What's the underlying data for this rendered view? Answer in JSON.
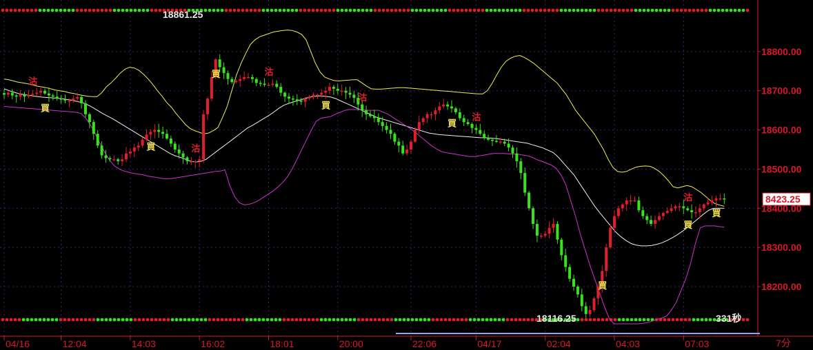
{
  "chart_data": {
    "type": "candlestick",
    "title": "",
    "xlabel": "",
    "ylabel": "",
    "timeframe_label": "7分",
    "ylim": [
      18105,
      18900
    ],
    "y_ticks": [
      18200,
      18300,
      18400,
      18500,
      18600,
      18700,
      18800
    ],
    "y_tick_labels": [
      "18200.00",
      "18300.00",
      "18400.00",
      "18500.00",
      "18600.00",
      "18700.00",
      "18800.00"
    ],
    "x_ticks": [
      {
        "label": "04/16",
        "index": 0
      },
      {
        "label": "12:04",
        "index": 14
      },
      {
        "label": "14:03",
        "index": 31
      },
      {
        "label": "16:02",
        "index": 48
      },
      {
        "label": "18:01",
        "index": 65
      },
      {
        "label": "20:00",
        "index": 82
      },
      {
        "label": "22:06",
        "index": 100
      },
      {
        "label": "04/17",
        "index": 116
      },
      {
        "label": "02:04",
        "index": 133
      },
      {
        "label": "04:03",
        "index": 150
      },
      {
        "label": "07:03",
        "index": 167
      }
    ],
    "last_price": 18423.25,
    "last_price_label": "8423.25",
    "annotations": {
      "high_label": "18861.25",
      "low_label": "18116.25",
      "countdown_label": "331秒"
    },
    "closes": [
      18690,
      18695,
      18688,
      18685,
      18690,
      18685,
      18690,
      18692,
      18695,
      18700,
      18693,
      18688,
      18685,
      18680,
      18678,
      18675,
      18675,
      18680,
      18684,
      18668,
      18640,
      18620,
      18590,
      18560,
      18535,
      18528,
      18525,
      18525,
      18520,
      18525,
      18540,
      18545,
      18555,
      18560,
      18575,
      18588,
      18595,
      18600,
      18595,
      18590,
      18578,
      18565,
      18550,
      18540,
      18530,
      18520,
      18520,
      18520,
      18525,
      18640,
      18680,
      18735,
      18780,
      18760,
      18745,
      18730,
      18722,
      18725,
      18730,
      18735,
      18735,
      18730,
      18720,
      18718,
      18715,
      18715,
      18718,
      18710,
      18695,
      18685,
      18680,
      18678,
      18675,
      18672,
      18680,
      18685,
      18690,
      18690,
      18695,
      18700,
      18710,
      18705,
      18700,
      18700,
      18695,
      18690,
      18682,
      18665,
      18650,
      18640,
      18635,
      18630,
      18620,
      18610,
      18600,
      18590,
      18570,
      18560,
      18540,
      18550,
      18570,
      18600,
      18620,
      18630,
      18640,
      18640,
      18650,
      18660,
      18665,
      18660,
      18655,
      18645,
      18630,
      18620,
      18615,
      18605,
      18600,
      18590,
      18580,
      18575,
      18572,
      18570,
      18570,
      18565,
      18555,
      18540,
      18520,
      18490,
      18440,
      18400,
      18360,
      18330,
      18330,
      18335,
      18350,
      18360,
      18320,
      18280,
      18250,
      18220,
      18200,
      18180,
      18150,
      18130,
      18140,
      18170,
      18200,
      18240,
      18300,
      18350,
      18380,
      18400,
      18410,
      18420,
      18420,
      18420,
      18395,
      18380,
      18370,
      18360,
      18370,
      18380,
      18388,
      18393,
      18400,
      18405,
      18405,
      18400,
      18395,
      18390,
      18390,
      18400,
      18410,
      18415,
      18420,
      18425,
      18425,
      18423.25
    ],
    "bands": {
      "upper": [
        18730,
        18728,
        18725,
        18722,
        18720,
        18718,
        18715,
        18712,
        18710,
        18708,
        18705,
        18702,
        18700,
        18698,
        18695,
        18693,
        18690,
        18688,
        18686,
        18685,
        18685,
        18695,
        18710,
        18720,
        18732,
        18745,
        18755,
        18760,
        18758,
        18752,
        18742,
        18730,
        18716,
        18700,
        18686,
        18670,
        18658,
        18642,
        18628,
        18614,
        18604,
        18598,
        18594,
        18590,
        18592,
        18598,
        18606,
        18632,
        18660,
        18700,
        18740,
        18770,
        18795,
        18818,
        18830,
        18838,
        18842,
        18846,
        18850,
        18852,
        18854,
        18855,
        18854,
        18850,
        18844,
        18830,
        18800,
        18770,
        18748,
        18735,
        18730,
        18726,
        18725,
        18726,
        18727,
        18728,
        18728,
        18720,
        18712,
        18705,
        18704,
        18704,
        18705,
        18706,
        18707,
        18708,
        18708,
        18707,
        18706,
        18705,
        18704,
        18703,
        18702,
        18701,
        18700,
        18699,
        18698,
        18697,
        18696,
        18695,
        18694,
        18693,
        18692,
        18692,
        18700,
        18718,
        18740,
        18760,
        18775,
        18783,
        18788,
        18790,
        18785,
        18778,
        18770,
        18760,
        18750,
        18740,
        18730,
        18720,
        18705,
        18690,
        18670,
        18650,
        18635,
        18620,
        18605,
        18590,
        18570,
        18550,
        18525,
        18505,
        18494,
        18492,
        18494,
        18500,
        18505,
        18507,
        18508,
        18507,
        18502,
        18494,
        18483,
        18470,
        18455,
        18452,
        18455,
        18458,
        18455,
        18448,
        18440,
        18430,
        18420,
        18412,
        18408,
        18405
      ],
      "middle": [
        18705,
        18700,
        18696,
        18692,
        18690,
        18688,
        18686,
        18684,
        18683,
        18682,
        18681,
        18680,
        18678,
        18676,
        18673,
        18670,
        18665,
        18658,
        18650,
        18642,
        18635,
        18628,
        18620,
        18612,
        18604,
        18596,
        18588,
        18580,
        18572,
        18564,
        18556,
        18548,
        18540,
        18534,
        18530,
        18525,
        18520,
        18518,
        18520,
        18525,
        18535,
        18545,
        18555,
        18565,
        18575,
        18585,
        18595,
        18605,
        18612,
        18620,
        18628,
        18636,
        18645,
        18655,
        18663,
        18668,
        18672,
        18676,
        18680,
        18684,
        18686,
        18687,
        18686,
        18684,
        18680,
        18674,
        18668,
        18662,
        18656,
        18650,
        18644,
        18638,
        18632,
        18628,
        18624,
        18620,
        18616,
        18612,
        18608,
        18604,
        18600,
        18596,
        18592,
        18590,
        18588,
        18587,
        18586,
        18585,
        18584,
        18583,
        18582,
        18581,
        18580,
        18580,
        18579,
        18578,
        18576,
        18574,
        18572,
        18570,
        18568,
        18566,
        18562,
        18558,
        18554,
        18548,
        18542,
        18530,
        18515,
        18500,
        18485,
        18465,
        18445,
        18425,
        18405,
        18388,
        18372,
        18356,
        18340,
        18328,
        18318,
        18310,
        18306,
        18304,
        18304,
        18305,
        18308,
        18312,
        18318,
        18325,
        18333,
        18342,
        18352,
        18363,
        18374,
        18385,
        18395,
        18400,
        18400,
        18400
      ],
      "lower": [
        18660,
        18659,
        18658,
        18657,
        18656,
        18655,
        18654,
        18653,
        18652,
        18651,
        18650,
        18649,
        18648,
        18647,
        18646,
        18645,
        18642,
        18630,
        18612,
        18590,
        18565,
        18542,
        18522,
        18508,
        18500,
        18495,
        18492,
        18489,
        18487,
        18485,
        18482,
        18480,
        18478,
        18476,
        18475,
        18476,
        18478,
        18480,
        18482,
        18484,
        18486,
        18488,
        18490,
        18492,
        18494,
        18495,
        18498,
        18458,
        18430,
        18414,
        18409,
        18410,
        18414,
        18420,
        18428,
        18436,
        18444,
        18454,
        18466,
        18480,
        18500,
        18525,
        18550,
        18575,
        18600,
        18622,
        18630,
        18632,
        18634,
        18640,
        18645,
        18650,
        18652,
        18652,
        18652,
        18651,
        18650,
        18650,
        18650,
        18645,
        18640,
        18632,
        18624,
        18616,
        18608,
        18600,
        18590,
        18580,
        18570,
        18560,
        18552,
        18545,
        18542,
        18540,
        18538,
        18536,
        18534,
        18532,
        18532,
        18534,
        18536,
        18538,
        18540,
        18540,
        18540,
        18539,
        18538,
        18538,
        18536,
        18534,
        18530,
        18524,
        18520,
        18515,
        18510,
        18502,
        18485,
        18460,
        18420,
        18380,
        18335,
        18295,
        18255,
        18220,
        18185,
        18150,
        18120,
        18105,
        18105,
        18105,
        18105,
        18105,
        18105,
        18106,
        18108,
        18112,
        18116,
        18120,
        18125,
        18140,
        18160,
        18190,
        18220,
        18260,
        18310,
        18350,
        18355,
        18355,
        18355,
        18353,
        18352
      ]
    },
    "signals": [
      {
        "label": "買",
        "index": 10,
        "kind": "buy"
      },
      {
        "label": "沽",
        "index": 7,
        "kind": "sell"
      },
      {
        "label": "買",
        "index": 36,
        "kind": "buy"
      },
      {
        "label": "沽",
        "index": 47,
        "kind": "sell"
      },
      {
        "label": "買",
        "index": 52,
        "kind": "buy"
      },
      {
        "label": "沽",
        "index": 65,
        "kind": "sell"
      },
      {
        "label": "買",
        "index": 79,
        "kind": "buy"
      },
      {
        "label": "沽",
        "index": 88,
        "kind": "sell"
      },
      {
        "label": "買",
        "index": 110,
        "kind": "buy"
      },
      {
        "label": "沽",
        "index": 116,
        "kind": "sell"
      },
      {
        "label": "買",
        "index": 147,
        "kind": "buy"
      },
      {
        "label": "沽",
        "index": 168,
        "kind": "sell"
      },
      {
        "label": "買",
        "index": 168,
        "kind": "buy"
      },
      {
        "label": "買",
        "index": 175,
        "kind": "buy"
      }
    ],
    "colors": {
      "background": "#000000",
      "up": "#e01f2a",
      "down": "#38e21c",
      "upper_band": "#f0f050",
      "middle_band": "#f0f0f0",
      "lower_band": "#d030d0",
      "axis": "#d8182a",
      "grid": "#3a2070",
      "signal_text": "#f0e050"
    }
  }
}
